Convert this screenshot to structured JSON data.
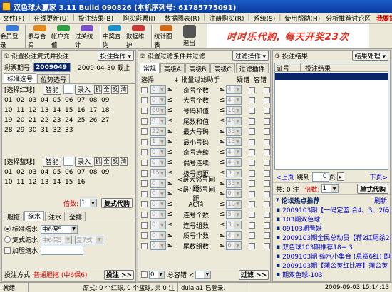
{
  "window": {
    "title": "双色球大赢家 3.11 Build 090826 (本机序列号: 61785775091)"
  },
  "menu": {
    "items": [
      "文件(F)",
      "在线更新(U)",
      "投注结果(B)",
      "购买彩票(I)",
      "数据图表(R)",
      "注册购买(R)",
      "系统(S)",
      "使用帮助(H)"
    ],
    "right": [
      "分析推荐讨论区",
      "我要提问"
    ]
  },
  "toolbar": {
    "buttons": [
      {
        "label": "会员登录",
        "icon": "user-icon",
        "color": "#3a7bd5"
      },
      {
        "label": "参与合买",
        "icon": "group-icon",
        "color": "#e08a1e"
      },
      {
        "label": "帐户充值",
        "icon": "card-icon",
        "color": "#2f9e44"
      },
      {
        "label": "过关统计",
        "icon": "chart-icon",
        "color": "#7b4fc8"
      },
      {
        "label": "中奖查询",
        "icon": "search-icon",
        "color": "#1e90c8"
      },
      {
        "label": "数据维护",
        "icon": "database-icon",
        "color": "#c83a3a"
      },
      {
        "label": "统计图表",
        "icon": "bar-chart-icon",
        "color": "#d06a1a"
      },
      {
        "label": "退出",
        "icon": "exit-icon",
        "color": "#555555"
      }
    ],
    "banner": "时时乐代购, 每天开奖23次"
  },
  "left": {
    "header": "① 设置投注复式并投注",
    "header_btn": "投注操作 ▾",
    "period_label": "彩票期号:",
    "period_value": "2009049",
    "date": "2009-04-30 截止",
    "tabs": [
      "标准选号",
      "位势选号"
    ],
    "red_label": "[选择红球]",
    "blue_label": "[选择蓝球]",
    "smart": "智能",
    "quick": [
      "录入",
      "机",
      "全",
      "反",
      "清"
    ],
    "red_numbers": [
      "01",
      "02",
      "03",
      "04",
      "05",
      "06",
      "07",
      "08",
      "09",
      "10",
      "11",
      "12",
      "13",
      "14",
      "15",
      "16",
      "17",
      "18",
      "19",
      "20",
      "21",
      "22",
      "23",
      "24",
      "25",
      "26",
      "27",
      "28",
      "29",
      "30",
      "31",
      "32",
      "33"
    ],
    "blue_numbers": [
      "01",
      "02",
      "03",
      "04",
      "05",
      "06",
      "07",
      "08",
      "09",
      "10",
      "11",
      "12",
      "13",
      "14",
      "15",
      "16"
    ],
    "multiple_label": "倍数:",
    "multiple_value": "1",
    "fushi_btn": "复式代购",
    "sub_tabs": [
      "胆拖",
      "缩水",
      "注水",
      "全排"
    ],
    "standard_label": "标准缩水",
    "standard_value": "中6保5",
    "fushi_label": "复式缩水",
    "fushi_sel1": "中6保5",
    "fushi_sel2": "复7式",
    "add_dan": "加胆缩水",
    "method_label": "投注方式:",
    "method_value": "普通胆拖 (中6保6)",
    "bet_btn": "投注 >>"
  },
  "mid": {
    "header": "② 设置过滤条件并过滤",
    "header_btn": "过滤操作 ▾",
    "tabs": [
      "常规",
      "高级A",
      "高级B",
      "高级C",
      "过滤插件"
    ],
    "col_select": "选择",
    "col_batch": "↓ 批量过滤助手",
    "col_fault": "疑错",
    "col_tol": "容错",
    "rows": [
      {
        "v1": "0",
        "label": "奇号个数",
        "v2": "4"
      },
      {
        "v1": "0",
        "label": "大号个数",
        "v2": "4"
      },
      {
        "v1": "60",
        "label": "号码和值",
        "v2": "160"
      },
      {
        "v1": "0",
        "label": "尾数和值",
        "v2": "49"
      },
      {
        "v1": "22",
        "label": "最大号码",
        "v2": "33"
      },
      {
        "v1": "1",
        "label": "最小号码",
        "v2": "13"
      },
      {
        "v1": "0",
        "label": "奇号连续",
        "v2": "4"
      },
      {
        "v1": "0",
        "label": "偶号连续",
        "v2": "4"
      },
      {
        "v1": "15",
        "label": "极号间距",
        "v2": "33"
      },
      {
        "v1": "0",
        "label": "<最大邻号间距",
        "v2": "33"
      },
      {
        "v1": "0",
        "label": "<最小邻号间距",
        "v2": "0"
      },
      {
        "v1": "0",
        "label": "AC值",
        "v2": "10"
      },
      {
        "v1": "0",
        "label": "连号个数",
        "v2": "5"
      },
      {
        "v1": "0",
        "label": "连号组数",
        "v2": "3"
      },
      {
        "v1": "0",
        "label": "质号个数",
        "v2": "4"
      },
      {
        "v1": "0",
        "label": "尾数组数",
        "v2": "6"
      }
    ],
    "bottom_sel": "0",
    "bottom_label": "总容错 <",
    "bottom_sel2": "",
    "filter_btn": "过滤 >>"
  },
  "right": {
    "header": "③ 投注结果",
    "header_btn": "结果处理 ▾",
    "col_no": "证号",
    "col_result": "投注结果",
    "pager": {
      "first": "<上页",
      "jump": "跳到",
      "page": "0",
      "page_suffix": "页",
      "next": "下页>"
    },
    "total": "共: 0 注",
    "multiple_label": "倍数:",
    "multiple_value": "1",
    "buy_btn": "单式代购",
    "forum_title": "论坛热点推荐",
    "forum_refresh": "刷新",
    "forum_items": [
      "2009103期【一码定蓝 合4、3、2码】第1",
      "103期双色球",
      "09103期看好",
      "2009103期全民总动员【荐2红尾杀2红尾】",
      "双色球103期推荐18+ 3",
      "2009103期 缩水小集合 (悬赏6红) 即中即",
      "2009103期【蒲公英红比赛】蒲公英 (2) 统",
      "期双色球-103"
    ]
  },
  "status": {
    "left": "就绪",
    "middle": "原式: 0 个红球, 0 个篮球, 共 0 注",
    "user": "dulala1 已登录.",
    "time": "2009-09-03 15:14:13"
  }
}
